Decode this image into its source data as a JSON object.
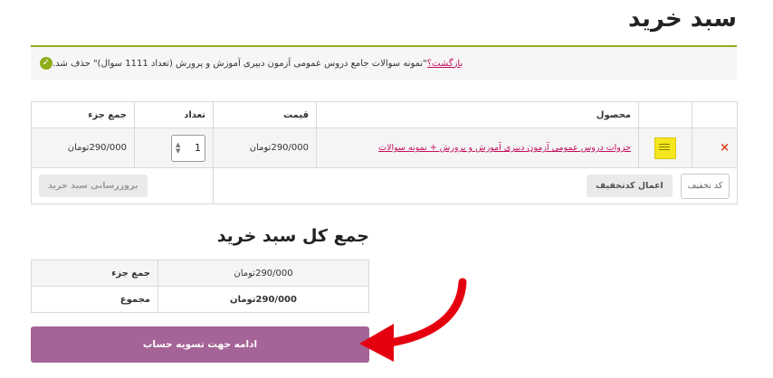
{
  "page": {
    "title": "سبد خرید"
  },
  "notice": {
    "message": "\"نمونه سوالات جامع دروس عمومی آزمون دبیری آموزش و پرورش (تعداد 1111 سوال)\" حذف شد.",
    "undo_label": "بازگشت؟",
    "icon": "check-circle-icon",
    "accent_color": "#8fae1b"
  },
  "cart": {
    "headers": {
      "product": "محصول",
      "price": "قیمت",
      "quantity": "تعداد",
      "subtotal": "جمع جزء"
    },
    "items": [
      {
        "remove_icon": "×",
        "product_name": "جزوات دروس عمومی آزمون دبیری آموزش و پرورش + نمونه سوالات",
        "price": "290/000تومان",
        "quantity": "1",
        "subtotal": "290/000تومان"
      }
    ],
    "coupon_placeholder": "کد تخفیف",
    "apply_coupon_label": "اعمال کدتخفیف",
    "update_cart_label": "بروزرسانی سبد خرید"
  },
  "totals": {
    "title": "جمع کل سبد خرید",
    "subtotal_label": "جمع جزء",
    "subtotal_value": "290/000تومان",
    "total_label": "مجموع",
    "total_value": "290/000تومان"
  },
  "checkout": {
    "label": "ادامه جهت تسویه حساب",
    "color": "#a46497"
  },
  "annotation": {
    "arrow_color": "#e5000f"
  }
}
